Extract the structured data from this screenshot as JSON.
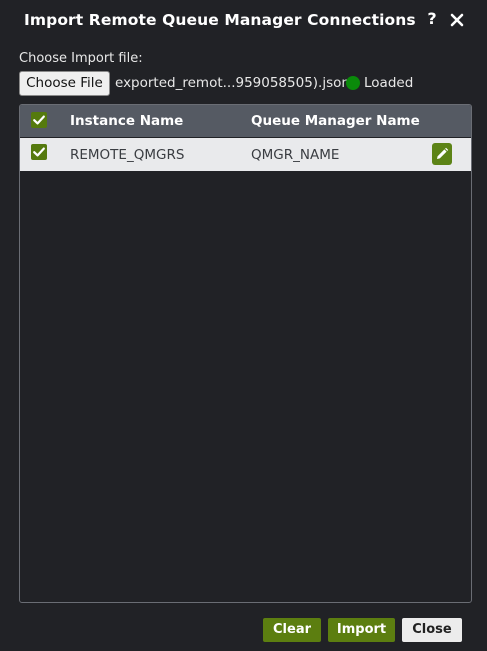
{
  "dialog": {
    "title": "Import Remote Queue Manager Connections",
    "help_label": "?"
  },
  "file": {
    "label": "Choose Import file:",
    "button_label": "Choose File",
    "file_name": "exported_remot...959058505).json",
    "status": "Loaded",
    "status_color": "#0a8a0a"
  },
  "table": {
    "select_all_checked": true,
    "columns": [
      "Instance Name",
      "Queue Manager Name"
    ],
    "rows": [
      {
        "checked": true,
        "instance_name": "REMOTE_QMGRS",
        "queue_manager_name": "QMGR_NAME"
      }
    ]
  },
  "footer": {
    "clear_label": "Clear",
    "import_label": "Import",
    "close_label": "Close"
  },
  "colors": {
    "background": "#212226",
    "accent": "#5c7e10",
    "header_bg": "#555a63",
    "row_bg": "#e9eaec"
  },
  "icons": {
    "help": "question-mark",
    "close": "close-x",
    "status": "green-dot",
    "checkbox": "check-mark",
    "edit": "pencil"
  }
}
